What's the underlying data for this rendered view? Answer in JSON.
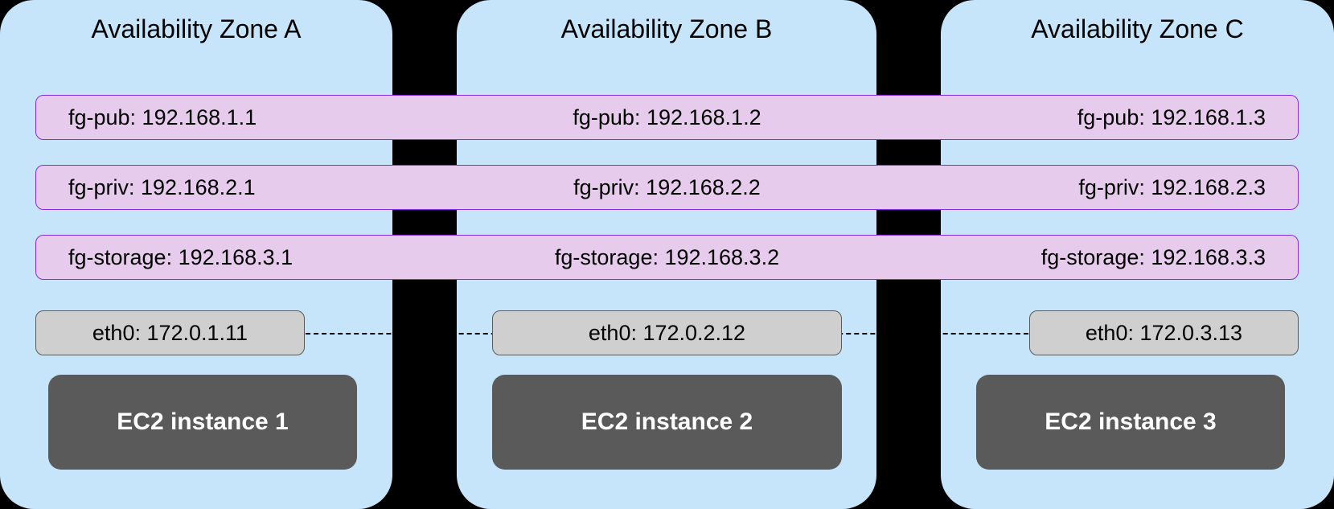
{
  "zones": {
    "a": {
      "title": "Availability Zone A"
    },
    "b": {
      "title": "Availability Zone B"
    },
    "c": {
      "title": "Availability Zone C"
    }
  },
  "subnets": {
    "pub": {
      "a": "fg-pub: 192.168.1.1",
      "b": "fg-pub: 192.168.1.2",
      "c": "fg-pub: 192.168.1.3"
    },
    "priv": {
      "a": "fg-priv: 192.168.2.1",
      "b": "fg-priv: 192.168.2.2",
      "c": "fg-priv: 192.168.2.3"
    },
    "stor": {
      "a": "fg-storage: 192.168.3.1",
      "b": "fg-storage: 192.168.3.2",
      "c": "fg-storage: 192.168.3.3"
    }
  },
  "eth": {
    "a": "eth0: 172.0.1.11",
    "b": "eth0: 172.0.2.12",
    "c": "eth0: 172.0.3.13"
  },
  "ec2": {
    "a": "EC2 instance 1",
    "b": "EC2 instance 2",
    "c": "EC2 instance 3"
  }
}
